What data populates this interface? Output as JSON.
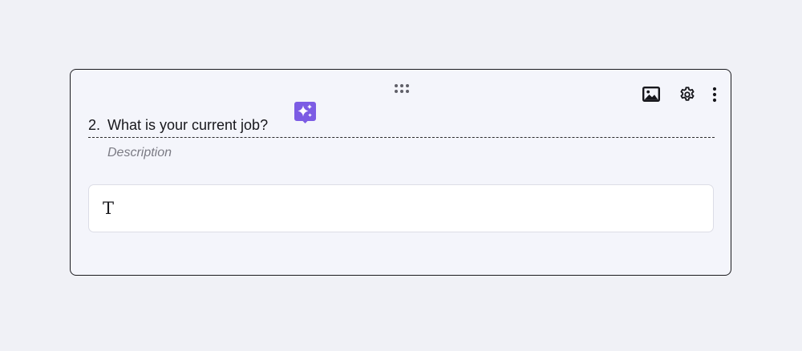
{
  "question": {
    "number": "2.",
    "title": "What is your current job?",
    "description_placeholder": "Description"
  },
  "answer_field": {
    "type_icon": "T"
  },
  "icons": {
    "drag": "drag-handle-icon",
    "image": "image-icon",
    "settings": "gear-icon",
    "more": "more-vertical-icon",
    "ai": "ai-sparkle-icon"
  },
  "colors": {
    "ai_badge": "#7c5ce4",
    "card_border": "#1b1b1f",
    "card_background": "#f4f5fb"
  }
}
